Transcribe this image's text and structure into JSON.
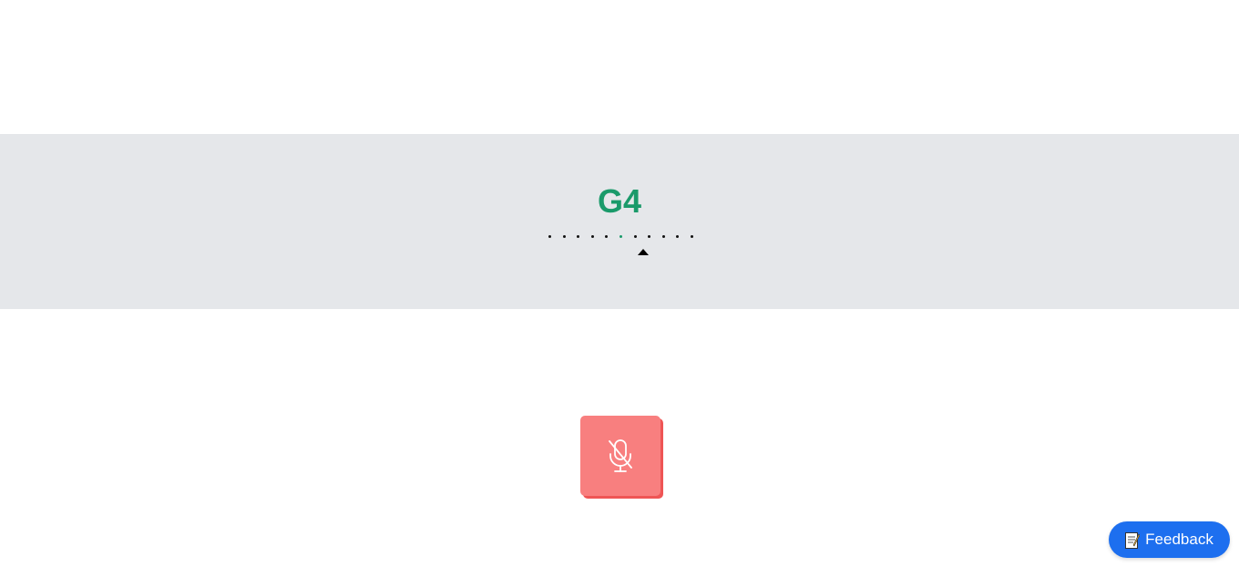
{
  "tuner": {
    "note": "G4",
    "scale_ticks": 11,
    "center_tick_index": 5,
    "pointer_offset_ticks": 1.6,
    "colors": {
      "band": "#e5e7ea",
      "note": "#1a9a6a",
      "tick": "#111111",
      "center_tick": "#1a9a6a"
    }
  },
  "mic_button": {
    "icon": "mic-off-icon",
    "state": "muted",
    "color": "#f87f7f"
  },
  "feedback": {
    "label": "Feedback",
    "icon": "memo-icon",
    "color": "#1d6fef"
  }
}
